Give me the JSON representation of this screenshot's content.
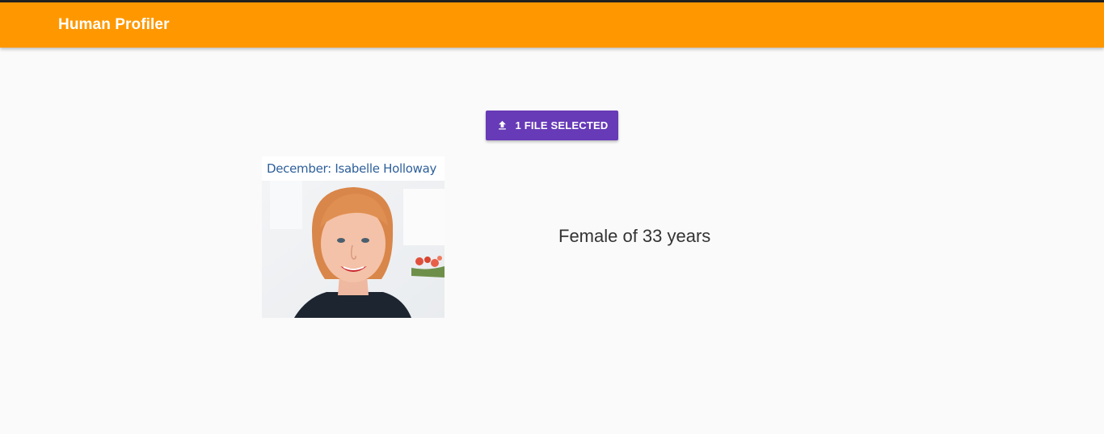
{
  "app": {
    "title": "Human Profiler",
    "bar_color": "#ff9800"
  },
  "upload": {
    "label": "1 FILE SELECTED",
    "icon": "upload-icon",
    "color": "#673ab7"
  },
  "photo": {
    "caption": "December: Isabelle Holloway"
  },
  "result": {
    "text": "Female of 33 years"
  }
}
